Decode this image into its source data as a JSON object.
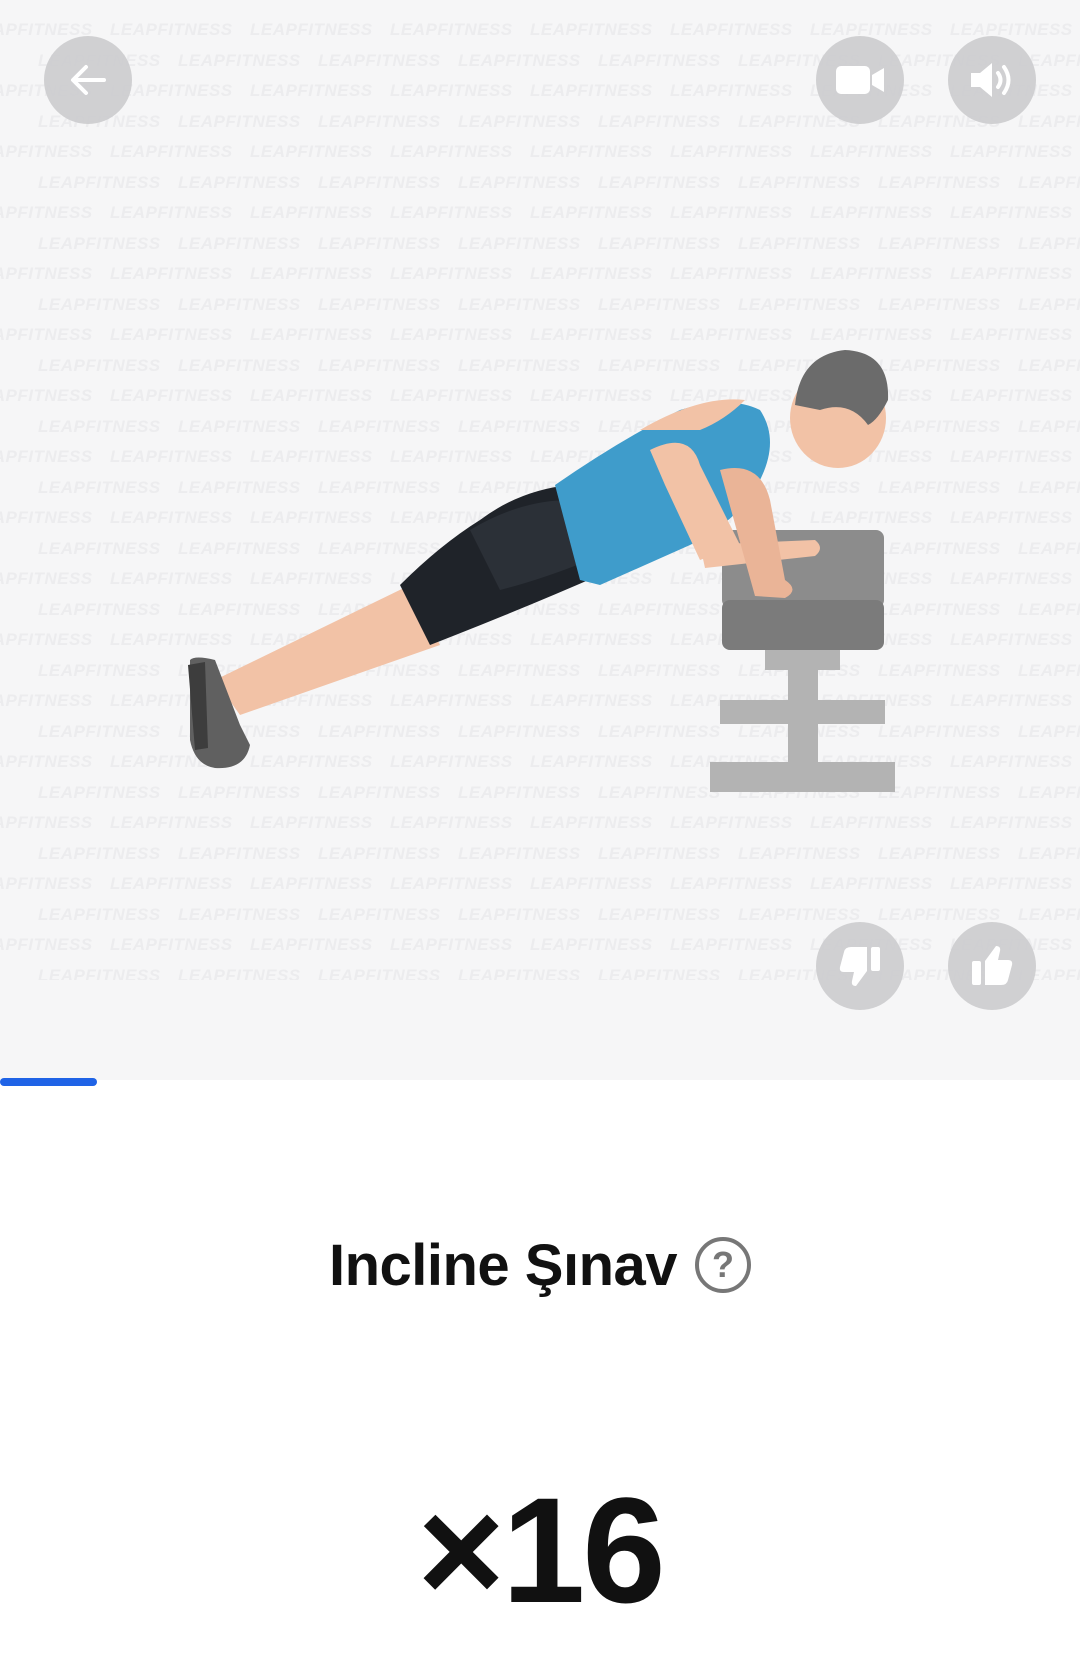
{
  "watermark": {
    "text": "LEAPFITNESS"
  },
  "exercise": {
    "name": "Incline Şınav",
    "reps_label": "×16",
    "help_glyph": "?"
  },
  "progress": {
    "fraction": 0.09
  },
  "colors": {
    "accent": "#1f63e6",
    "button_bg": "#cdcdd0",
    "shirt": "#3f9ccb",
    "shorts": "#1f2329",
    "skin": "#f2c2a6",
    "shoe": "#606060",
    "bench": "#8a8a8a"
  },
  "icons": {
    "back": "arrow-left-icon",
    "video": "video-camera-icon",
    "sound": "speaker-volume-icon",
    "dislike": "thumbs-down-icon",
    "like": "thumbs-up-icon",
    "help": "question-circle-icon"
  }
}
